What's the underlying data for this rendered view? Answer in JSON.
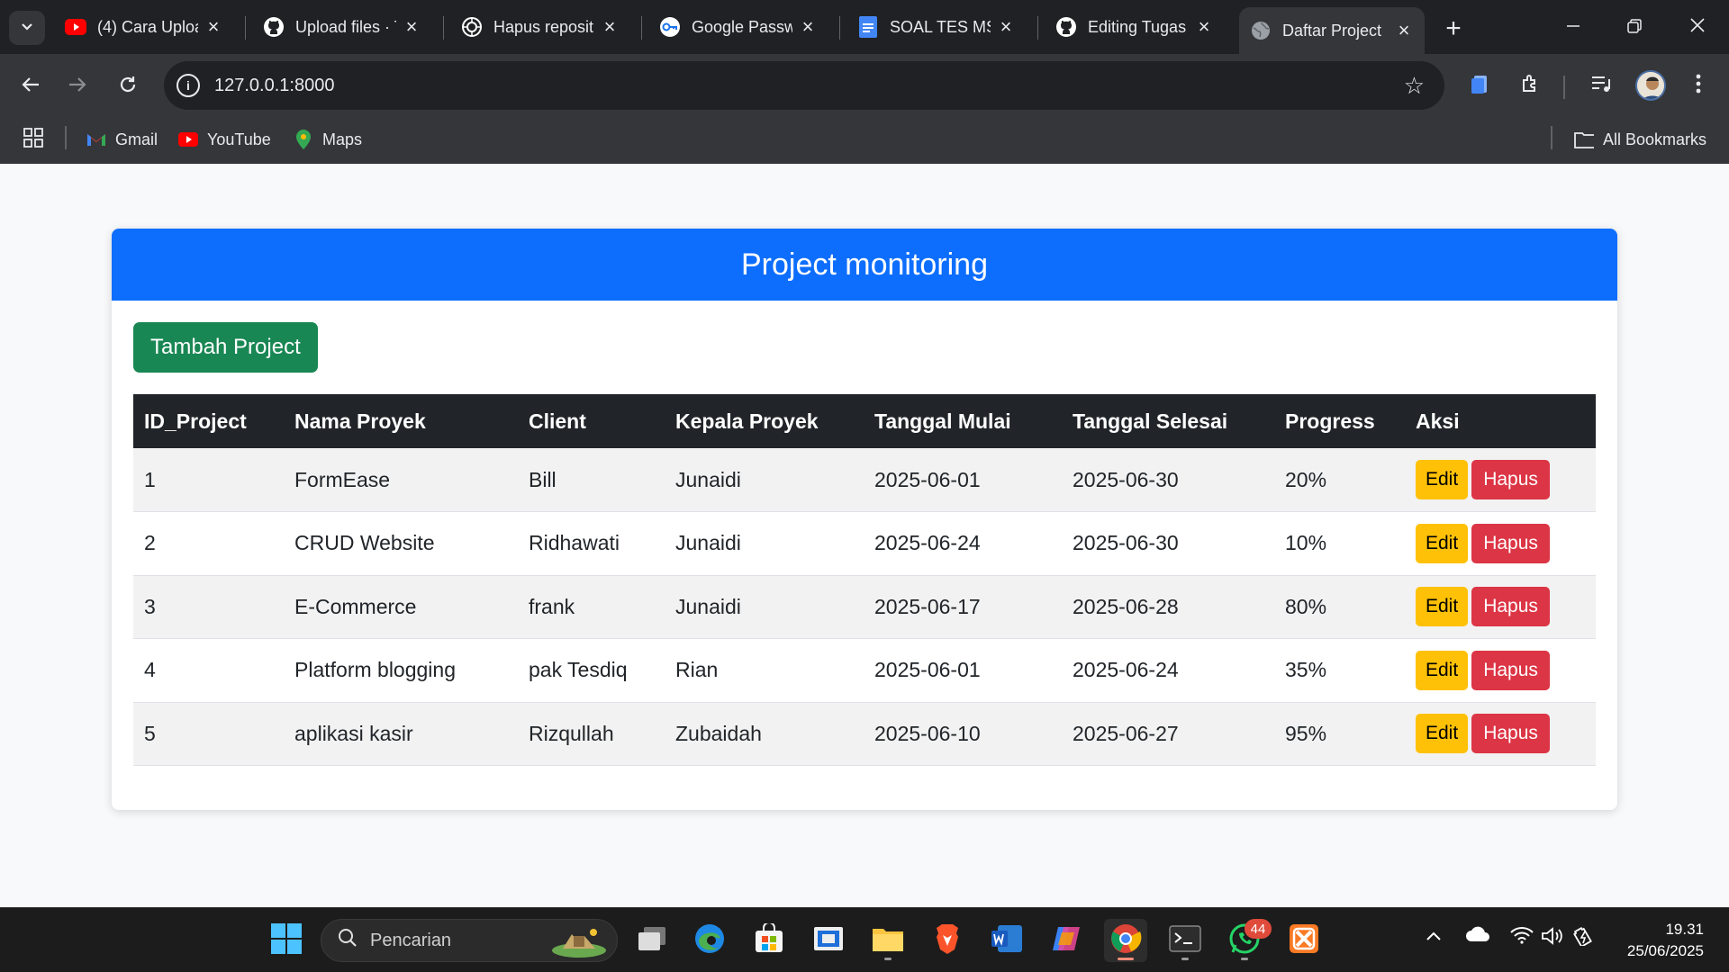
{
  "browser": {
    "tabs": [
      {
        "title": "(4) Cara Uploa",
        "icon": "youtube-icon"
      },
      {
        "title": "Upload files · T",
        "icon": "github-icon"
      },
      {
        "title": "Hapus reposit",
        "icon": "chatgpt-icon"
      },
      {
        "title": "Google Passw",
        "icon": "google-password-icon"
      },
      {
        "title": "SOAL TES MSI",
        "icon": "google-docs-icon"
      },
      {
        "title": "Editing Tugas",
        "icon": "github-icon"
      },
      {
        "title": "Daftar Project",
        "icon": "globe-icon"
      }
    ],
    "url": "127.0.0.1:8000",
    "bookmarks": [
      {
        "label": "Gmail",
        "icon": "gmail-icon"
      },
      {
        "label": "YouTube",
        "icon": "youtube-icon"
      },
      {
        "label": "Maps",
        "icon": "maps-icon"
      }
    ],
    "all_bookmarks_label": "All Bookmarks"
  },
  "page": {
    "header_title": "Project monitoring",
    "add_button_label": "Tambah Project",
    "table": {
      "columns": [
        "ID_Project",
        "Nama Proyek",
        "Client",
        "Kepala Proyek",
        "Tanggal Mulai",
        "Tanggal Selesai",
        "Progress",
        "Aksi"
      ],
      "rows": [
        {
          "id": "1",
          "name": "FormEase",
          "client": "Bill",
          "lead": "Junaidi",
          "start": "2025-06-01",
          "end": "2025-06-30",
          "progress": "20%"
        },
        {
          "id": "2",
          "name": "CRUD Website",
          "client": "Ridhawati",
          "lead": "Junaidi",
          "start": "2025-06-24",
          "end": "2025-06-30",
          "progress": "10%"
        },
        {
          "id": "3",
          "name": "E-Commerce",
          "client": "frank",
          "lead": "Junaidi",
          "start": "2025-06-17",
          "end": "2025-06-28",
          "progress": "80%"
        },
        {
          "id": "4",
          "name": "Platform blogging",
          "client": "pak Tesdiq",
          "lead": "Rian",
          "start": "2025-06-01",
          "end": "2025-06-24",
          "progress": "35%"
        },
        {
          "id": "5",
          "name": "aplikasi kasir",
          "client": "Rizqullah",
          "lead": "Zubaidah",
          "start": "2025-06-10",
          "end": "2025-06-27",
          "progress": "95%"
        }
      ],
      "edit_label": "Edit",
      "delete_label": "Hapus"
    }
  },
  "taskbar": {
    "search_placeholder": "Pencarian",
    "whatsapp_badge": "44",
    "time": "19.31",
    "date": "25/06/2025"
  },
  "colors": {
    "primary": "#0d6efd",
    "success": "#198754",
    "warning": "#ffc107",
    "danger": "#dc3545",
    "dark": "#212529"
  }
}
